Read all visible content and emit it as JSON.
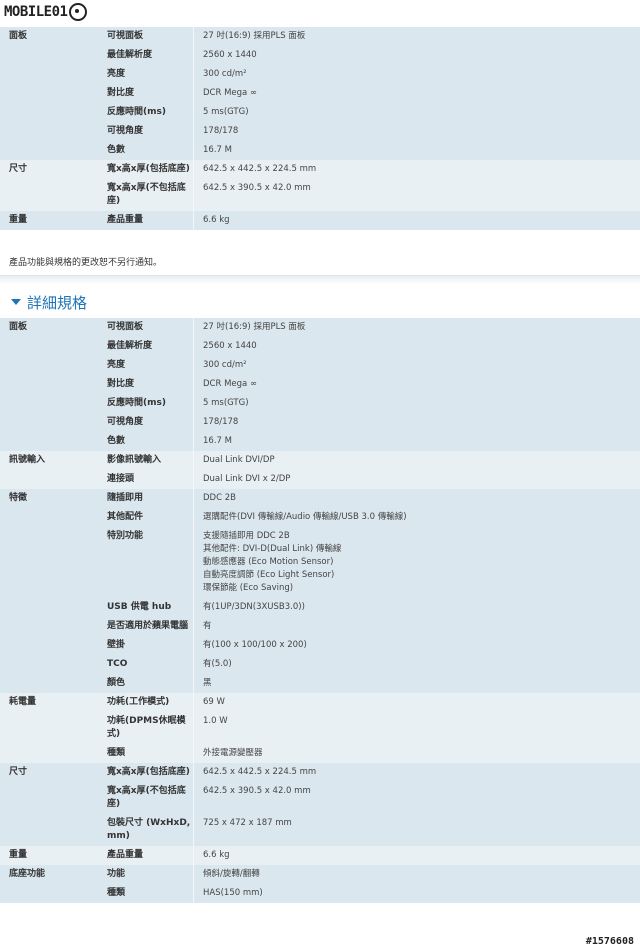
{
  "logo_text": "MOBILE01",
  "table1": [
    {
      "c1": "面板",
      "c2": "可視面板",
      "c3": "27 吋(16:9) 採用PLS 面板"
    },
    {
      "c1": "",
      "c2": "最佳解析度",
      "c3": "2560 x 1440"
    },
    {
      "c1": "",
      "c2": "亮度",
      "c3": "300 cd/m²"
    },
    {
      "c1": "",
      "c2": "對比度",
      "c3": "DCR Mega ∞"
    },
    {
      "c1": "",
      "c2": "反應時間(ms)",
      "c3": "5 ms(GTG)"
    },
    {
      "c1": "",
      "c2": "可視角度",
      "c3": "178/178"
    },
    {
      "c1": "",
      "c2": "色數",
      "c3": "16.7 M"
    },
    {
      "c1": "尺寸",
      "c2": "寬x高x厚(包括底座)",
      "c3": "642.5 x 442.5 x 224.5 mm"
    },
    {
      "c1": "",
      "c2": "寬x高x厚(不包括底座)",
      "c3": "642.5 x 390.5 x 42.0 mm"
    },
    {
      "c1": "重量",
      "c2": "產品重量",
      "c3": "6.6 kg"
    }
  ],
  "notice": "產品功能與規格的更改恕不另行通知。",
  "section_title": "詳細規格",
  "table2": [
    {
      "c1": "面板",
      "c2": "可視面板",
      "c3": "27 吋(16:9) 採用PLS 面板"
    },
    {
      "c1": "",
      "c2": "最佳解析度",
      "c3": "2560 x 1440"
    },
    {
      "c1": "",
      "c2": "亮度",
      "c3": "300 cd/m²"
    },
    {
      "c1": "",
      "c2": "對比度",
      "c3": "DCR Mega ∞"
    },
    {
      "c1": "",
      "c2": "反應時間(ms)",
      "c3": "5 ms(GTG)"
    },
    {
      "c1": "",
      "c2": "可視角度",
      "c3": "178/178"
    },
    {
      "c1": "",
      "c2": "色數",
      "c3": "16.7 M"
    },
    {
      "c1": "訊號輸入",
      "c2": "影像訊號輸入",
      "c3": "Dual Link DVI/DP"
    },
    {
      "c1": "",
      "c2": "連接頭",
      "c3": "Dual Link DVI x 2/DP"
    },
    {
      "c1": "特徵",
      "c2": "隨插即用",
      "c3": "DDC 2B"
    },
    {
      "c1": "",
      "c2": "其他配件",
      "c3": "選購配件(DVI 傳輸線/Audio 傳輸線/USB 3.0 傳輸線)"
    },
    {
      "c1": "",
      "c2": "特別功能",
      "c3": "支援隨插即用 DDC 2B\n其他配件: DVI-D(Dual Link) 傳輸線\n動態感應器 (Eco Motion Sensor)\n自動亮度調節 (Eco Light Sensor)\n環保節能 (Eco Saving)"
    },
    {
      "c1": "",
      "c2": "USB 供電 hub",
      "c3": "有(1UP/3DN(3XUSB3.0))"
    },
    {
      "c1": "",
      "c2": "是否適用於蘋果電腦",
      "c3": "有"
    },
    {
      "c1": "",
      "c2": "壁掛",
      "c3": "有(100 x 100/100 x 200)"
    },
    {
      "c1": "",
      "c2": "TCO",
      "c3": "有(5.0)"
    },
    {
      "c1": "",
      "c2": "顏色",
      "c3": "黑"
    },
    {
      "c1": "耗電量",
      "c2": "功耗(工作模式)",
      "c3": "69 W"
    },
    {
      "c1": "",
      "c2": "功耗(DPMS休眠模式)",
      "c3": "1.0 W"
    },
    {
      "c1": "",
      "c2": "種類",
      "c3": "外接電源變壓器"
    },
    {
      "c1": "尺寸",
      "c2": "寬x高x厚(包括底座)",
      "c3": "642.5 x 442.5 x 224.5 mm"
    },
    {
      "c1": "",
      "c2": "寬x高x厚(不包括底座)",
      "c3": "642.5 x 390.5 x 42.0 mm"
    },
    {
      "c1": "",
      "c2": "包裝尺寸 (WxHxD, mm)",
      "c3": "725 x 472 x 187 mm"
    },
    {
      "c1": "重量",
      "c2": "產品重量",
      "c3": "6.6 kg"
    },
    {
      "c1": "底座功能",
      "c2": "功能",
      "c3": "傾斜/旋轉/翻轉"
    },
    {
      "c1": "",
      "c2": "種類",
      "c3": "HAS(150 mm)"
    }
  ],
  "watermark": "#1576608"
}
